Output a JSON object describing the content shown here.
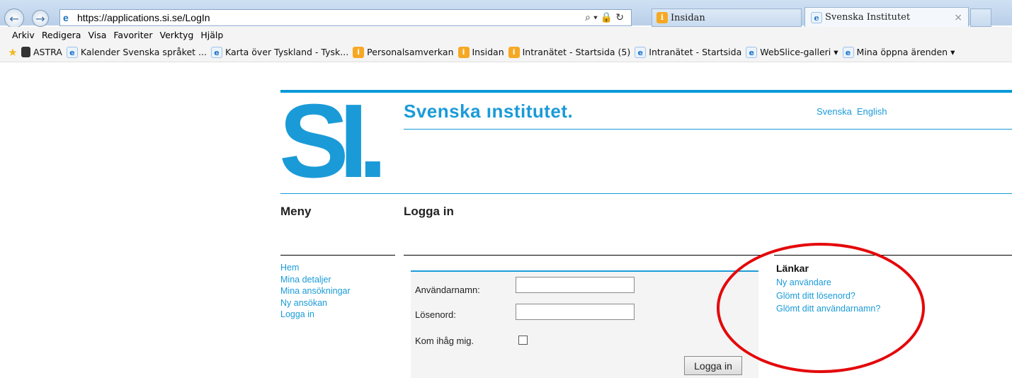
{
  "browser": {
    "address": "https://applications.si.se/LogIn",
    "tabs": [
      {
        "label": "Insidan"
      },
      {
        "label": "Svenska Institutet"
      }
    ],
    "menu": [
      "Arkiv",
      "Redigera",
      "Visa",
      "Favoriter",
      "Verktyg",
      "Hjälp"
    ],
    "favorites": [
      {
        "label": "ASTRA",
        "icon": "book-icon"
      },
      {
        "label": "Kalender Svenska språket ...",
        "icon": "ie-icon"
      },
      {
        "label": "Karta över Tyskland - Tysk...",
        "icon": "ie-icon"
      },
      {
        "label": "Personalsamverkan",
        "icon": "intranet-icon"
      },
      {
        "label": "Insidan",
        "icon": "intranet-icon"
      },
      {
        "label": "Intranätet - Startsida (5)",
        "icon": "intranet-icon"
      },
      {
        "label": "Intranätet - Startsida",
        "icon": "ie-icon"
      },
      {
        "label": "WebSlice-galleri ▾",
        "icon": "ie-icon"
      },
      {
        "label": "Mina öppna ärenden ▾",
        "icon": "ie-icon"
      }
    ]
  },
  "site": {
    "logo": "SI.",
    "title": "Svenska ınstitutet.",
    "lang": [
      "Svenska",
      "English"
    ]
  },
  "menu_heading": "Meny",
  "page_heading": "Logga in",
  "nav": [
    "Hem",
    "Mina detaljer",
    "Mina ansökningar",
    "Ny ansökan",
    "Logga in"
  ],
  "form": {
    "username_label": "Användarnamn:",
    "username_value": "",
    "password_label": "Lösenord:",
    "password_value": "",
    "remember_label": "Kom ihåg mig.",
    "submit_label": "Logga in"
  },
  "links": {
    "title": "Länkar",
    "items": [
      "Ny användare",
      "Glömt ditt lösenord?",
      "Glömt ditt användarnamn?"
    ]
  },
  "colors": {
    "accent": "#1a9bd8",
    "annotation": "#e4080a"
  }
}
